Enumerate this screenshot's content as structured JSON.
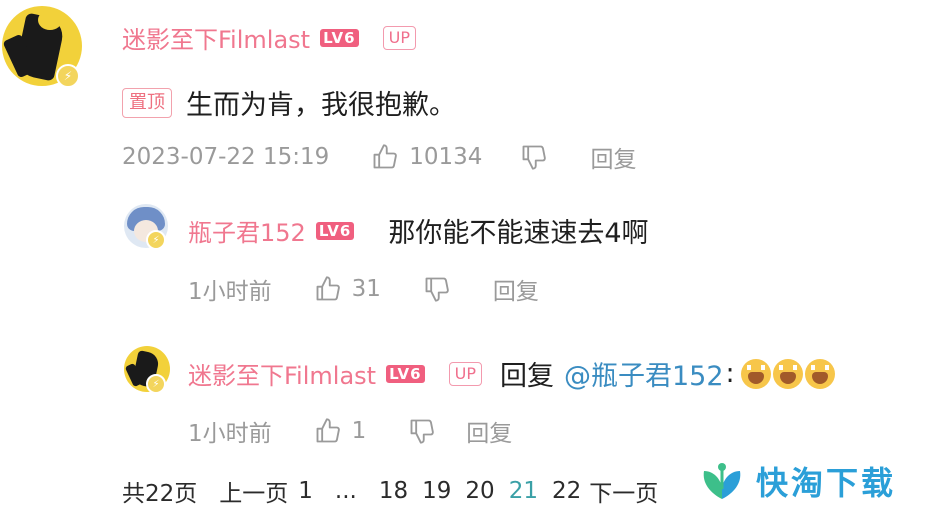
{
  "main_comment": {
    "username": "迷影至下Filmlast",
    "level_badge": "LV6",
    "up_badge": "UP",
    "pin_label": "置顶",
    "content": "生而为肯，我很抱歉。",
    "timestamp": "2023-07-22 15:19",
    "like_count": "10134",
    "reply_label": "回复"
  },
  "reply_1": {
    "username": "瓶子君152",
    "level_badge": "LV6",
    "content": "那你能不能速速去4啊",
    "timestamp": "1小时前",
    "like_count": "31",
    "reply_label": "回复"
  },
  "reply_2": {
    "username": "迷影至下Filmlast",
    "level_badge": "LV6",
    "up_badge": "UP",
    "reply_prefix": "回复",
    "mention": "@瓶子君152",
    "colon": ":",
    "timestamp": "1小时前",
    "like_count": "1",
    "reply_label": "回复"
  },
  "pagination": {
    "total": "共22页",
    "prev": "上一页",
    "pages": [
      "1",
      "...",
      "18",
      "19",
      "20",
      "21",
      "22"
    ],
    "active_page": "21",
    "next": "下一页"
  },
  "watermark": {
    "text": "快淘下载"
  },
  "icons": {
    "like": "thumbs-up-icon",
    "dislike": "thumbs-down-icon",
    "verified": "verified-badge-icon",
    "emoji": "crying-laugh-emoji"
  },
  "colors": {
    "username": "#f0778f",
    "level_badge": "#f05f7f",
    "mention": "#3a8cc1",
    "active_page": "#3aa0a6",
    "meta_gray": "#9a9a9a",
    "watermark": "#2b9fd8"
  }
}
